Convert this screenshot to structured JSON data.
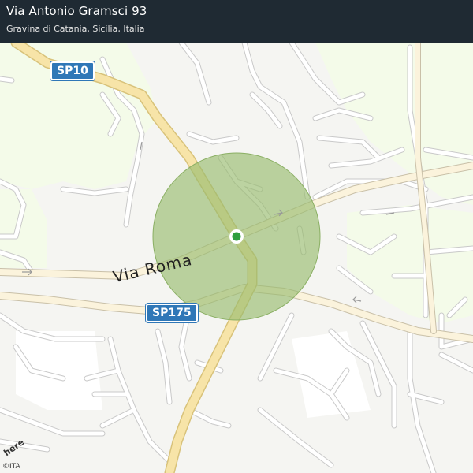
{
  "header": {
    "title": "Via Antonio Gramsci 93",
    "subtitle": "Gravina di Catania, Sicilia, Italia"
  },
  "map": {
    "street_label": "Via Roma",
    "shields": {
      "sp10": "SP10",
      "sp175": "SP175"
    },
    "colors": {
      "background": "#f5f5f2",
      "green_area": "#f4fbe9",
      "road": "#ffffff",
      "main_road": "#f7e4a8",
      "accuracy_circle": "#98bb6f",
      "marker": "#2e9e3e",
      "shield": "#2f77b7"
    },
    "attribution": "©ITA",
    "logo": "here"
  }
}
